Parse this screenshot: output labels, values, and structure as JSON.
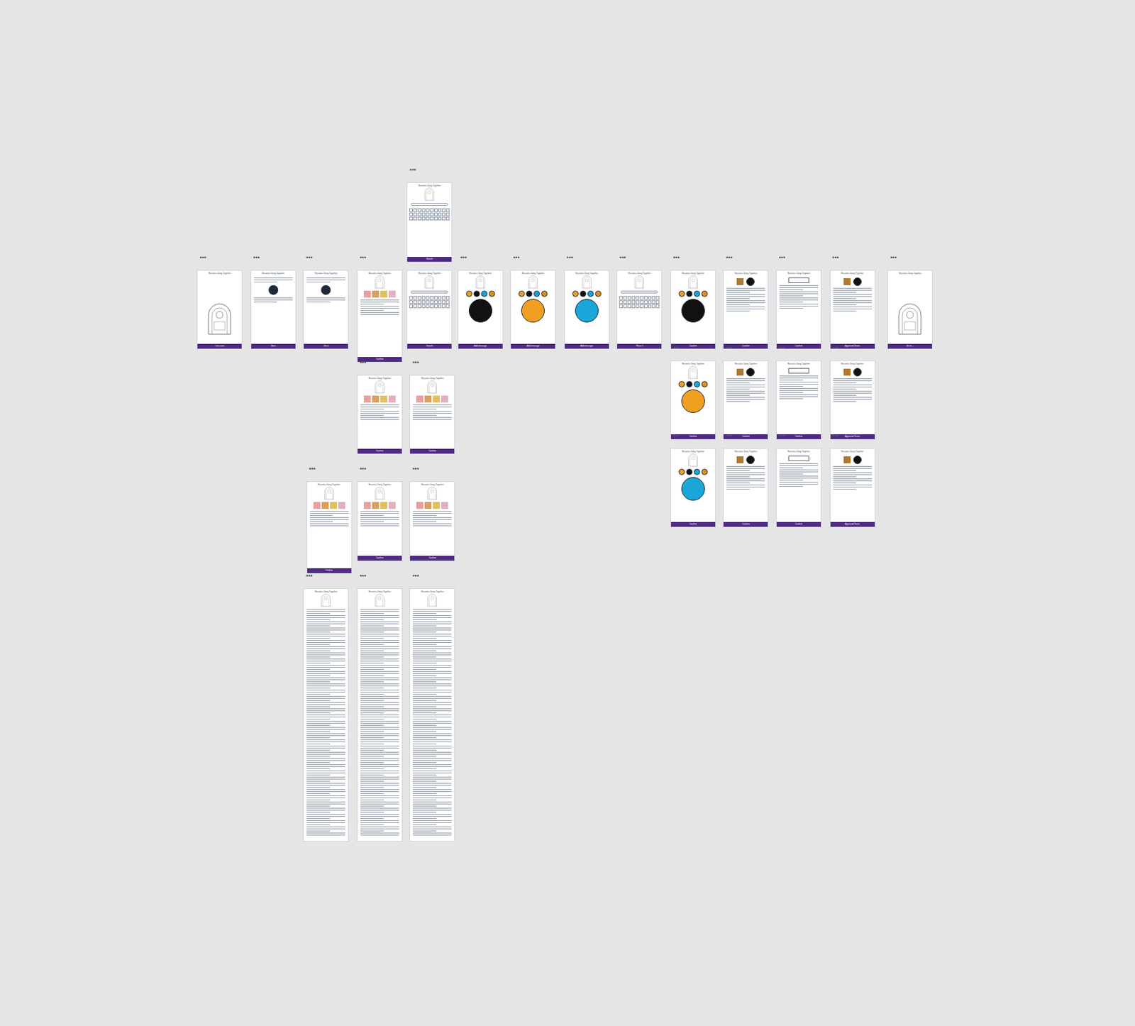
{
  "canvas": {
    "frame_menu": "•••",
    "frames": [
      {
        "title": "Record a Song Together",
        "kind": "jukebox",
        "button": "Let's start"
      },
      {
        "title": "Record a Song Together",
        "kind": "steps",
        "button": "Next"
      },
      {
        "title": "Record a Song Together",
        "kind": "steps",
        "button": "Got it"
      },
      {
        "title": "Record a Song Together",
        "kind": "photos",
        "button": "Confirm"
      },
      {
        "title": "Record a Song Together",
        "kind": "keyboard",
        "button": "Search"
      },
      {
        "title": "Record a Song Together",
        "kind": "vinyl",
        "button": "Add message",
        "color": "#111111"
      },
      {
        "title": "Record a Song Together",
        "kind": "vinyl",
        "button": "Add message",
        "color": "#f0a020"
      },
      {
        "title": "Record a Song Together",
        "kind": "vinyl",
        "button": "Add message",
        "color": "#1aa6d8"
      },
      {
        "title": "Record a Song Together",
        "kind": "keyboard",
        "button": "Place it"
      },
      {
        "title": "Record a Song Together",
        "kind": "vinyl",
        "button": "Confirm",
        "color": "#111111"
      },
      {
        "title": "Record a Song Together",
        "kind": "order",
        "button": "Confirm"
      },
      {
        "title": "Record a Song Together",
        "kind": "form",
        "button": "Confirm"
      },
      {
        "title": "Record a Song Together",
        "kind": "order",
        "button": "Approved Terms"
      },
      {
        "title": "Record a Song Together",
        "kind": "jukebox",
        "button": "Go to ..."
      },
      {
        "title": "Record a Song Together",
        "kind": "keyboard",
        "button": "Search"
      },
      {
        "title": "Record a Song Together",
        "kind": "photos",
        "button": "Confirm"
      },
      {
        "title": "Record a Song Together",
        "kind": "photos",
        "button": "Confirm"
      },
      {
        "title": "Record a Song Together",
        "kind": "vinyl",
        "button": "Confirm",
        "color": "#f0a020"
      },
      {
        "title": "Record a Song Together",
        "kind": "order",
        "button": "Confirm"
      },
      {
        "title": "Record a Song Together",
        "kind": "form",
        "button": "Confirm"
      },
      {
        "title": "Record a Song Together",
        "kind": "order",
        "button": "Approved Terms"
      },
      {
        "title": "Record a Song Together",
        "kind": "vinyl",
        "button": "Confirm",
        "color": "#1aa6d8"
      },
      {
        "title": "Record a Song Together",
        "kind": "order",
        "button": "Confirm"
      },
      {
        "title": "Record a Song Together",
        "kind": "form",
        "button": "Confirm"
      },
      {
        "title": "Record a Song Together",
        "kind": "order",
        "button": "Approved Terms"
      },
      {
        "title": "Record a Song Together",
        "kind": "photos",
        "button": "Confirm"
      },
      {
        "title": "Record a Song Together",
        "kind": "photos",
        "button": "Confirm"
      },
      {
        "title": "Record a Song Together",
        "kind": "photos",
        "button": "Confirm"
      },
      {
        "title": "Record a Song Together",
        "kind": "lyrics",
        "button": ""
      },
      {
        "title": "Record a Song Together",
        "kind": "lyrics",
        "button": ""
      },
      {
        "title": "Record a Song Together",
        "kind": "lyrics",
        "button": ""
      }
    ]
  }
}
